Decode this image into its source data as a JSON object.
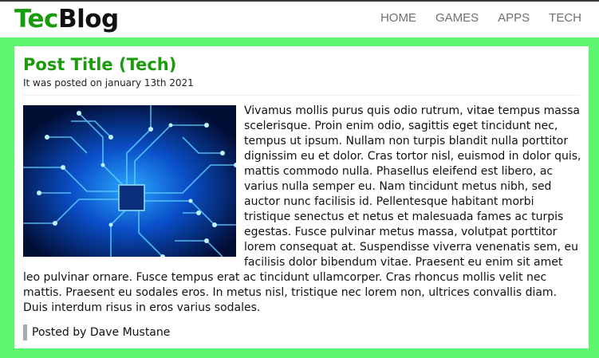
{
  "brand": {
    "part1": "Tec",
    "part2": "Blog"
  },
  "nav": [
    {
      "label": "HOME"
    },
    {
      "label": "GAMES"
    },
    {
      "label": "APPS"
    },
    {
      "label": "TECH"
    }
  ],
  "post": {
    "title": "Post Title (Tech)",
    "date": "It was posted on january 13th 2021",
    "image_icon": "circuit-board-image",
    "body": "Vivamus mollis purus quis odio rutrum, vitae tempus massa scelerisque. Proin enim odio, sagittis eget tincidunt nec, tempus ut ipsum. Nullam non turpis blandit nulla porttitor dignissim eu et dolor. Cras tortor nisl, euismod in dolor quis, mattis commodo nulla. Phasellus eleifend est libero, ac varius nulla semper eu. Nam tincidunt metus nibh, sed auctor nunc facilisis id. Pellentesque habitant morbi tristique senectus et netus et malesuada fames ac turpis egestas. Fusce pulvinar metus massa, volutpat porttitor lorem consequat at. Suspendisse viverra venenatis sem, eu facilisis dolor bibendum vitae. Praesent eu enim sit amet leo pulvinar ornare. Fusce tempus erat ac tincidunt ullamcorper. Cras rhoncus mollis velit nec mattis. Praesent eu sodales eros. In metus nisl, tristique nec lorem non, ultrices convallis diam. Duis interdum risus in eros varius sodales.",
    "author": "Posted by Dave Mustane"
  },
  "colors": {
    "page_background": "#5cf76f",
    "brand_green": "#1a9b0c",
    "nav_text": "#707070"
  }
}
